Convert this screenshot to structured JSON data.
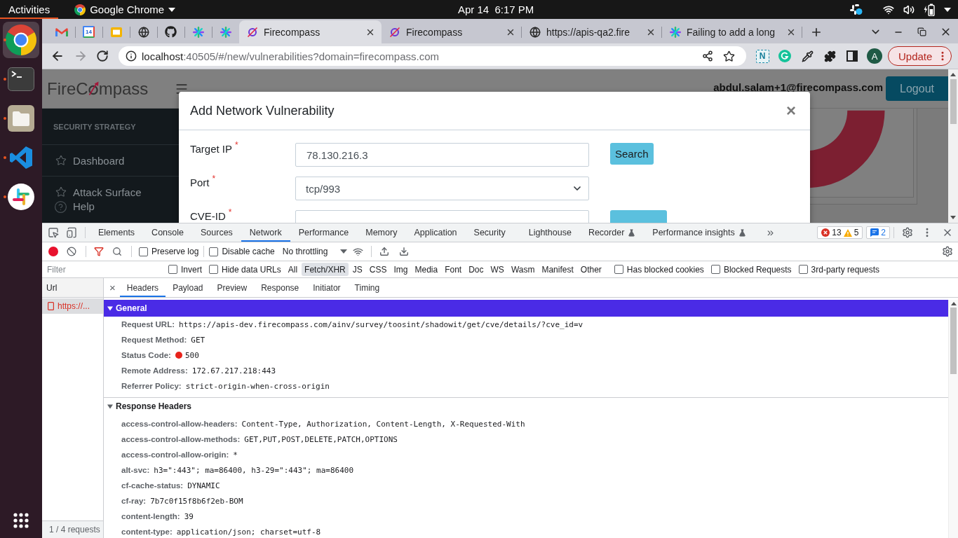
{
  "top_bar": {
    "activities": "Activities",
    "app_menu": "Google Chrome",
    "clock": "Apr 14  6:17 PM"
  },
  "dock": {
    "apps": [
      {
        "kind": "browser",
        "running": true,
        "selected": true
      },
      {
        "kind": "terminal",
        "running": true,
        "selected": false
      },
      {
        "kind": "files",
        "running": true,
        "selected": false
      },
      {
        "kind": "editor",
        "running": true,
        "selected": false
      },
      {
        "kind": "chat",
        "running": true,
        "selected": false
      }
    ]
  },
  "browser": {
    "pinned_tabs": [
      {
        "kind": "mail"
      },
      {
        "kind": "calendar",
        "text": "14"
      },
      {
        "kind": "slides"
      },
      {
        "kind": "globe"
      },
      {
        "kind": "octocat"
      },
      {
        "kind": "asterisk"
      },
      {
        "kind": "asterisk"
      }
    ],
    "tabs": [
      {
        "kind": "compass",
        "title": "Firecompass",
        "selected": true
      },
      {
        "kind": "compass",
        "title": "Firecompass",
        "selected": false
      },
      {
        "kind": "globe",
        "title": "https://apis-qa2.fire",
        "selected": false
      },
      {
        "kind": "asterisk",
        "title": "Failing to add a long",
        "selected": false
      }
    ],
    "back_enabled": true,
    "forward_enabled": false,
    "address": {
      "host": "localhost",
      "path": ":40505/#/new/vulnerabilities?domain=firecompass.com"
    },
    "extensions": [
      {
        "kind": "letter",
        "text": "N"
      },
      {
        "kind": "swirl"
      },
      {
        "kind": "eyedropper"
      },
      {
        "kind": "puzzle"
      },
      {
        "kind": "side_panel"
      }
    ],
    "profile": "A",
    "update": "Update"
  },
  "page": {
    "logo": {
      "left": "FireC",
      "right": "mpass"
    },
    "user_email": "abdul.salam+1@firecompass.com",
    "logout": "Logout",
    "sidebar": {
      "section": "SECURITY STRATEGY",
      "items": [
        {
          "label": "Dashboard"
        },
        {
          "label": "Attack Surface"
        }
      ],
      "help": "Help"
    },
    "modal": {
      "title": "Add Network Vulnerability",
      "close": "×",
      "fields": [
        {
          "kind": "input",
          "label": "Target IP",
          "mark": "*",
          "value": "78.130.216.3",
          "button": "Search"
        },
        {
          "kind": "select",
          "label": "Port",
          "mark": "*",
          "value": "tcp/993"
        },
        {
          "kind": "input",
          "label": "CVE-ID",
          "mark": "*",
          "has_button": true
        }
      ]
    }
  },
  "devtools": {
    "panel_tabs": [
      {
        "label": "Elements",
        "selected": false
      },
      {
        "label": "Console",
        "selected": false
      },
      {
        "label": "Sources",
        "selected": false
      },
      {
        "label": "Network",
        "selected": true
      },
      {
        "label": "Performance",
        "selected": false
      },
      {
        "label": "Memory",
        "selected": false
      },
      {
        "label": "Application",
        "selected": false
      },
      {
        "label": "Security",
        "selected": false
      },
      {
        "label": "Lighthouse",
        "selected": false
      },
      {
        "label": "Recorder",
        "selected": false,
        "experimental": true
      },
      {
        "label": "Performance insights",
        "selected": false,
        "experimental": true
      }
    ],
    "more_tabs": "»",
    "issues": {
      "errors": "13",
      "warnings": "5",
      "messages": "2"
    },
    "recording": true,
    "filter_active": true,
    "options": [
      {
        "label": "Preserve log",
        "checked": false
      },
      {
        "label": "Disable cache",
        "checked": false
      }
    ],
    "throttling": "No throttling",
    "filter": {
      "placeholder": "Filter",
      "options": [
        {
          "label": "Invert",
          "checked": false
        },
        {
          "label": "Hide data URLs",
          "checked": false
        }
      ],
      "types": [
        {
          "label": "All",
          "selected": false
        },
        {
          "label": "Fetch/XHR",
          "selected": true
        },
        {
          "label": "JS",
          "selected": false
        },
        {
          "label": "CSS",
          "selected": false
        },
        {
          "label": "Img",
          "selected": false
        },
        {
          "label": "Media",
          "selected": false
        },
        {
          "label": "Font",
          "selected": false
        },
        {
          "label": "Doc",
          "selected": false
        },
        {
          "label": "WS",
          "selected": false
        },
        {
          "label": "Wasm",
          "selected": false
        },
        {
          "label": "Manifest",
          "selected": false
        },
        {
          "label": "Other",
          "selected": false
        }
      ],
      "more_options": [
        {
          "label": "Has blocked cookies",
          "checked": false
        },
        {
          "label": "Blocked Requests",
          "checked": false
        },
        {
          "label": "3rd-party requests",
          "checked": false
        }
      ]
    },
    "requests": {
      "column": "Url",
      "rows": [
        {
          "name": "https://...",
          "selected": true,
          "failed": true
        }
      ],
      "summary": "1 / 4 requests"
    },
    "detail": {
      "close": "×",
      "tabs": [
        {
          "label": "Headers",
          "selected": true
        },
        {
          "label": "Payload",
          "selected": false
        },
        {
          "label": "Preview",
          "selected": false
        },
        {
          "label": "Response",
          "selected": false
        },
        {
          "label": "Initiator",
          "selected": false
        },
        {
          "label": "Timing",
          "selected": false
        }
      ],
      "sections": [
        {
          "title": "General",
          "expanded": true,
          "focused": true,
          "rows": [
            {
              "name": "Request URL:",
              "value": "https://apis-dev.firecompass.com/ainv/survey/toosint/shadowit/get/cve/details/?cve_id=v"
            },
            {
              "name": "Request Method:",
              "value": "GET"
            },
            {
              "name": "Status Code:",
              "value": "500",
              "color": "#e8231b"
            },
            {
              "name": "Remote Address:",
              "value": "172.67.217.218:443"
            },
            {
              "name": "Referrer Policy:",
              "value": "strict-origin-when-cross-origin"
            }
          ]
        },
        {
          "title": "Response Headers",
          "expanded": true,
          "focused": false,
          "rows": [
            {
              "name": "access-control-allow-headers:",
              "value": "Content-Type, Authorization, Content-Length, X-Requested-With"
            },
            {
              "name": "access-control-allow-methods:",
              "value": "GET,PUT,POST,DELETE,PATCH,OPTIONS"
            },
            {
              "name": "access-control-allow-origin:",
              "value": "*"
            },
            {
              "name": "alt-svc:",
              "value": "h3=\":443\"; ma=86400, h3-29=\":443\"; ma=86400"
            },
            {
              "name": "cf-cache-status:",
              "value": "DYNAMIC"
            },
            {
              "name": "cf-ray:",
              "value": "7b7c0f15f8b6f2eb-BOM"
            },
            {
              "name": "content-length:",
              "value": "39"
            },
            {
              "name": "content-type:",
              "value": "application/json; charset=utf-8"
            }
          ]
        }
      ]
    }
  }
}
